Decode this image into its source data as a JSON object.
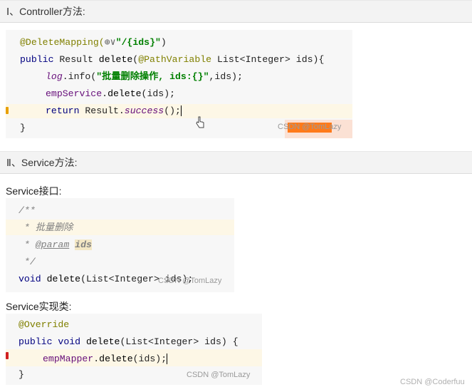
{
  "sections": [
    {
      "title": "Ⅰ、Controller方法:"
    },
    {
      "title": "Ⅱ、Service方法:"
    }
  ],
  "labels": {
    "service_interface": "Service接口:",
    "service_impl": "Service实现类:"
  },
  "controller_code": {
    "l1_ann": "@DeleteMapping(",
    "l1_icon": "⊕∨",
    "l1_str": "\"/{ids}\"",
    "l1_end": ")",
    "l2_kw": "public",
    "l2_a": " Result ",
    "l2_fn": "delete",
    "l2_b": "(",
    "l2_ann": "@PathVariable",
    "l2_c": " List<Integer> ids){",
    "l3_field": "log",
    "l3_a": ".info(",
    "l3_str": "\"批量删除操作, ids:{}\"",
    "l3_b": ",ids);",
    "l4_m": "empService",
    "l4_a": ".",
    "l4_fn": "delete",
    "l4_b": "(ids);",
    "l5_kw": "return",
    "l5_a": " Result.",
    "l5_m": "success",
    "l5_b": "();",
    "l6": "}",
    "watermark": "CSDN @TomLazy"
  },
  "interface_code": {
    "l1": "/**",
    "l2": " * 批量删除",
    "l3_a": " * ",
    "l3_tag": "@param",
    "l3_b": " ",
    "l3_ids": "ids",
    "l4": " */",
    "l5_kw": "void",
    "l5_a": " ",
    "l5_fn": "delete",
    "l5_b": "(List<Integer> ids);",
    "watermark": "CSDN @TomLazy"
  },
  "impl_code": {
    "l1": "@Override",
    "l2_kw": "public",
    "l2_a": " ",
    "l2_kw2": "void",
    "l2_b": " ",
    "l2_fn": "delete",
    "l2_c": "(List<Integer> ids) {",
    "l3_m": "empMapper",
    "l3_a": ".",
    "l3_fn": "delete",
    "l3_b": "(ids);",
    "l4": "}",
    "watermark": "CSDN @TomLazy"
  },
  "page_watermark": "CSDN @Coderfuu",
  "colors": {
    "keyword": "#000080",
    "annotation": "#808000",
    "string": "#008000",
    "member": "#660e7a",
    "comment": "#808080",
    "line_highlight": "#fdf7e6"
  }
}
